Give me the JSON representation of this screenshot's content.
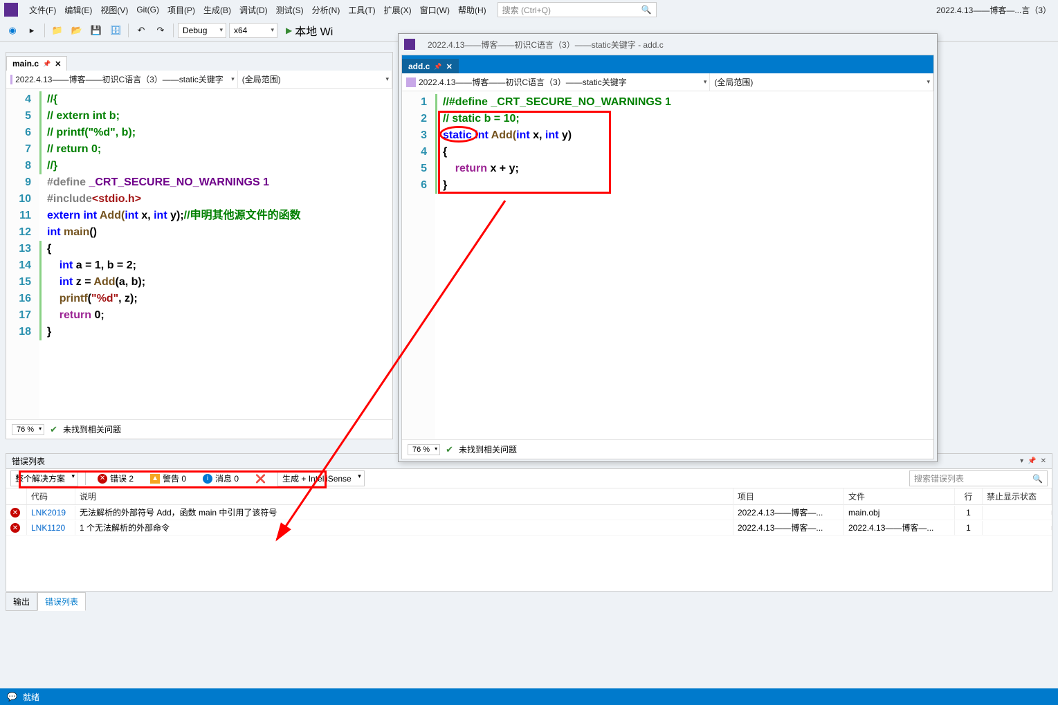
{
  "menu": {
    "items": [
      "文件(F)",
      "编辑(E)",
      "视图(V)",
      "Git(G)",
      "项目(P)",
      "生成(B)",
      "调试(D)",
      "测试(S)",
      "分析(N)",
      "工具(T)",
      "扩展(X)",
      "窗口(W)",
      "帮助(H)"
    ]
  },
  "search": {
    "placeholder": "搜索 (Ctrl+Q)"
  },
  "title_right": "2022.4.13——博客—...言（3）",
  "toolbar": {
    "config": "Debug",
    "platform": "x64",
    "run": "本地 Wi"
  },
  "editor_main": {
    "tab": "main.c",
    "nav_left": "2022.4.13——博客——初识C语言（3）——static关键字",
    "nav_right": "(全局范围)",
    "zoom": "76 %",
    "status_msg": "未找到相关问题",
    "lines": [
      4,
      5,
      6,
      7,
      8,
      9,
      10,
      11,
      12,
      13,
      14,
      15,
      16,
      17,
      18
    ]
  },
  "code_main": {
    "l4": "//{",
    "l5": "// extern int b;",
    "l6": "// printf(\"%d\", b);",
    "l7": "// return 0;",
    "l8": "//}",
    "define_pre": "#define ",
    "define_mac": "_CRT_SECURE_NO_WARNINGS 1",
    "include_pre": "#include",
    "include_hdr": "<stdio.h>",
    "extern": "extern int ",
    "add_decl": "Add(",
    "int_kw": "int ",
    "x": "x, ",
    "y": "y);",
    "cmt": "//申明其他源文件的函数",
    "main_kw": "int ",
    "main_fn": "main",
    "main_par": "()",
    "brace_o": "{",
    "brace_c": "}",
    "l14": "    int a = 1, b = 2;",
    "l15": "    int z = Add(a, b);",
    "printf": "printf",
    "fmt": "\"%d\"",
    "zarg": ", z);",
    "ret": "return ",
    "zero": "0;"
  },
  "float_win": {
    "title": "2022.4.13——博客——初识C语言（3）——static关键字 - add.c",
    "tab": "add.c",
    "nav_left": "2022.4.13——博客——初识C语言（3）——static关键字",
    "nav_right": "(全局范围)",
    "zoom": "76 %",
    "status_msg": "未找到相关问题",
    "lines": [
      1,
      2,
      3,
      4,
      5,
      6
    ]
  },
  "code_float": {
    "l1a": "//#define ",
    "l1b": "_CRT_SECURE_NO_WARNINGS 1",
    "l2": "// static b = 10;",
    "static": "static ",
    "int": "int ",
    "add": "Add(",
    "x": "x, ",
    "y": "y)",
    "l4": "{",
    "ret": "    return ",
    "xy": "x + y;",
    "l6": "}"
  },
  "error_panel": {
    "title": "错误列表",
    "scope": "整个解决方案",
    "err_btn": "错误 2",
    "warn_btn": "警告 0",
    "msg_btn": "消息 0",
    "build_combo": "生成 + IntelliSense",
    "search_ph": "搜索错误列表",
    "headers": {
      "code": "代码",
      "desc": "说明",
      "proj": "项目",
      "file": "文件",
      "line": "行",
      "supp": "禁止显示状态"
    },
    "rows": [
      {
        "code": "LNK2019",
        "desc": "无法解析的外部符号 Add，函数 main 中引用了该符号",
        "proj": "2022.4.13——博客—...",
        "file": "main.obj",
        "line": "1"
      },
      {
        "code": "LNK1120",
        "desc": "1 个无法解析的外部命令",
        "proj": "2022.4.13——博客—...",
        "file": "2022.4.13——博客—...",
        "line": "1"
      }
    ]
  },
  "bottom_tabs": {
    "output": "输出",
    "errors": "错误列表"
  },
  "statusbar": {
    "ready": "就绪"
  }
}
